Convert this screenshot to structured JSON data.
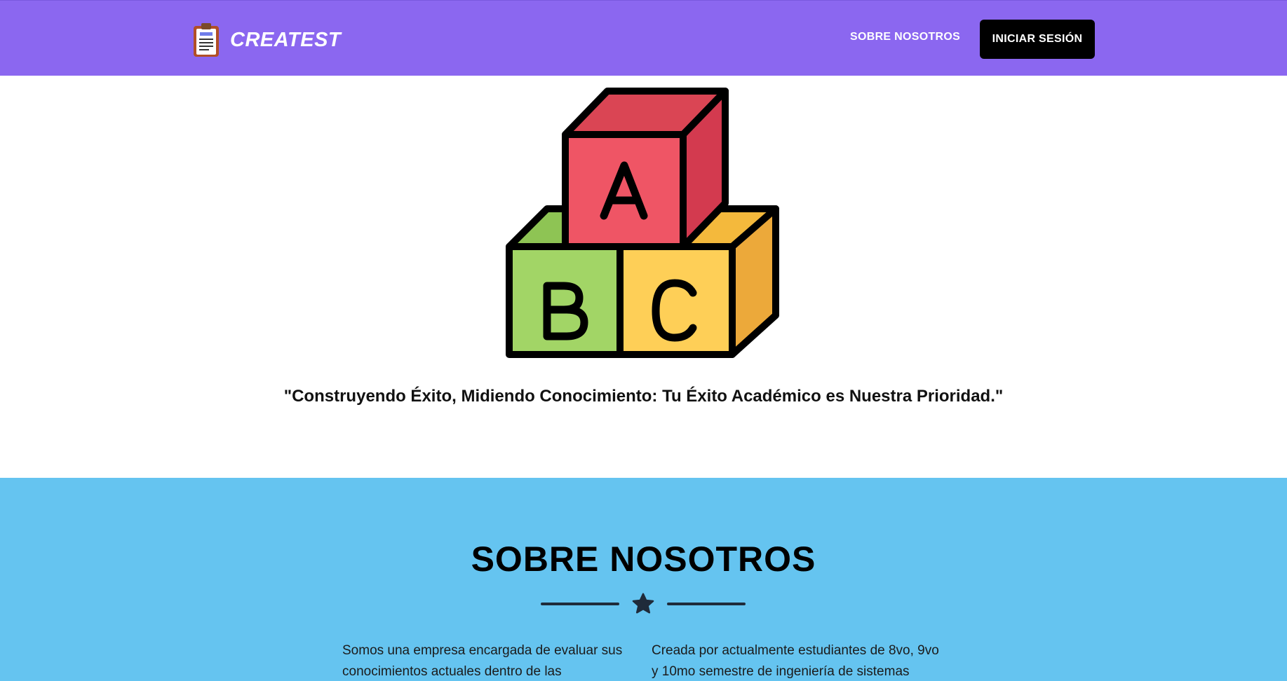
{
  "header": {
    "brand": "CREATEST",
    "nav_about": "SOBRE NOSOTROS",
    "login_label": "INICIAR SESIÓN"
  },
  "hero": {
    "blocks": [
      "A",
      "B",
      "C"
    ],
    "tagline": "\"Construyendo Éxito, Midiendo Conocimiento: Tu Éxito Académico es Nuestra Prioridad.\""
  },
  "about": {
    "title": "SOBRE NOSOTROS",
    "left_text": "Somos una empresa encargada de evaluar sus conocimientos actuales dentro de las",
    "right_text": "Creada por actualmente estudiantes de 8vo, 9vo y 10mo semestre de ingeniería de sistemas"
  },
  "colors": {
    "navbar": "#8b67f0",
    "about_bg": "#65c4f0",
    "block_red": "#ef5565",
    "block_green": "#a2d566",
    "block_yellow": "#fecf57"
  },
  "icons": {
    "logo": "clipboard-icon",
    "divider": "star-icon"
  }
}
